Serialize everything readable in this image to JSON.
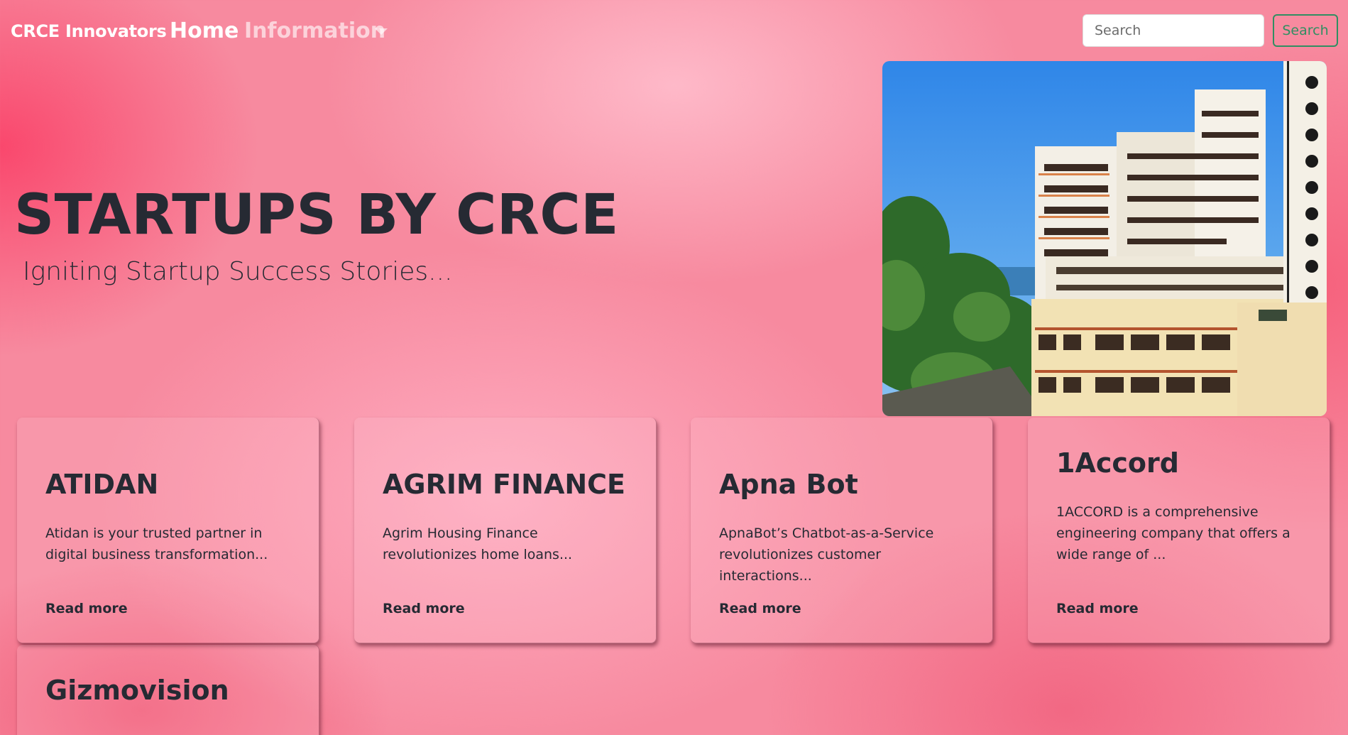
{
  "navbar": {
    "brand": "CRCE Innovators",
    "home_label": "Home",
    "information_label": "Information",
    "search_placeholder": "Search",
    "search_button_label": "Search"
  },
  "hero": {
    "title": "STARTUPS BY CRCE",
    "subtitle": "Igniting Startup Success Stories..."
  },
  "colors": {
    "accent_green": "#2f8f62",
    "text_dark": "#262a33",
    "background_pink": "#f78a9f"
  },
  "cards": [
    {
      "title": "ATIDAN",
      "description": "Atidan is your trusted partner in digital business transformation...",
      "link": "Read more"
    },
    {
      "title": "AGRIM FINANCE",
      "description": "Agrim Housing Finance revolutionizes home loans...",
      "link": "Read more"
    },
    {
      "title": "Apna Bot",
      "description": "ApnaBot’s Chatbot-as-a-Service revolutionizes customer interactions...",
      "link": "Read more"
    },
    {
      "title": "1Accord",
      "description": "1ACCORD is a comprehensive engineering company that offers a wide range of ...",
      "link": "Read more"
    },
    {
      "title": "Gizmovision"
    }
  ]
}
